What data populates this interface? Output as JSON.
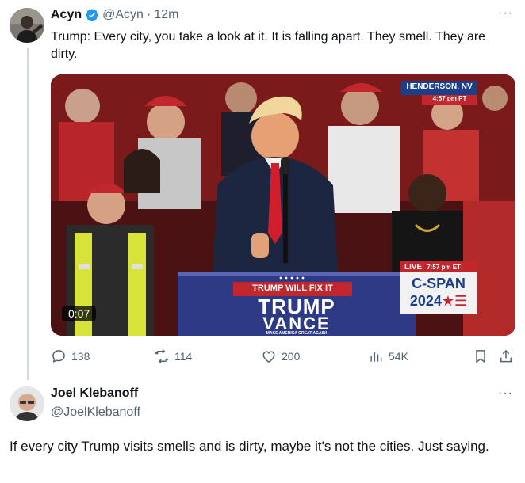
{
  "tweet1": {
    "name": "Acyn",
    "handle": "@Acyn",
    "separator": "·",
    "time": "12m",
    "text": "Trump: Every city, you take a look at it. It is falling apart. They smell. They are dirty.",
    "media": {
      "duration": "0:07",
      "location_tag": "HENDERSON, NV",
      "location_time": "4:57 pm PT",
      "live_label": "LIVE",
      "live_time": "7:57 pm ET",
      "network": "C-SPAN",
      "network_year": "2024",
      "podium_banner": "TRUMP WILL FIX IT",
      "podium_line1": "TRUMP",
      "podium_line2": "VANCE",
      "podium_small": "MAKE AMERICA GREAT AGAIN!"
    },
    "stats": {
      "replies": "138",
      "retweets": "114",
      "likes": "200",
      "views": "54K"
    }
  },
  "tweet2": {
    "name": "Joel Klebanoff",
    "handle": "@JoelKlebanoff",
    "text": "If every city Trump visits smells and is dirty, maybe it's not the cities. Just saying."
  },
  "colors": {
    "verified": "#1d9bf0",
    "secondary_text": "#536471",
    "thread_line": "#cfd9de"
  }
}
